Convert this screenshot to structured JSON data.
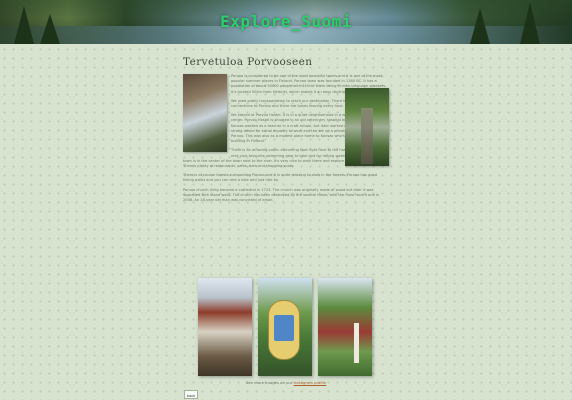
{
  "header": {
    "site_title": "Explore_Suomi"
  },
  "main": {
    "page_title": "Tervetuloa Porvooseen",
    "paragraphs": [
      "Porvoo is considered to be one of the most beautiful towns and it is one of the most popular summer places in Finland. Porvoo town was founded in 1380 BC. It has a population of about 50000 people with 44% of them being Finnish-language speakers. It's located 50km from Helsinki, which makes it an easy daytrip.",
      "We used public transportation to reach our destination. There is bus and train connections to Porvoo and there are buses leaving every hour.",
      "We stayed at Porvoo Hostel. It is in a quiet neighborhood in a walking distance from the center. Porvoo Hostel is situated in an old veterinary hospital built by Axel Kansas. Axel Kansas worked as a teacher in a craft school, but later worked as a farmer. He had a strong desire for social equality to work and the set up a private veterinary hospital in Porvoo. This was also as a modest place home to Kansas who's way this time of building in Finland.",
      "There is an amazing public swimming spot right next to the hostel, with beach. You can rent your favourite swimming gear to take and for rafting water activities. Porvoo's old town is in the center of the town next to the river. It's very nice to walk there and explore the narrow streets. There's plenty of restaurants, cafes, bars and shopping spots.",
      "There is of course forests surrounding Porvoo and it is quite relaxing to walk in the forests. Porvoo has good hiking paths and you can rent a bike and just ride by.",
      "Porvoo church Vinig became a cathedral in 1723. The church was originally made of wood but later it was upgraded with stone walls. The church has been destroyed by fire several times, with the most recent one in 2006. An 18-year old man was convicted of arson."
    ]
  },
  "gallery": {
    "images": [
      "alley-photo",
      "museum-sign-photo",
      "garden-photo"
    ],
    "caption_prefix": "See more images on our",
    "caption_link": "Instagram profile"
  },
  "footer": {
    "back_label": "back"
  }
}
